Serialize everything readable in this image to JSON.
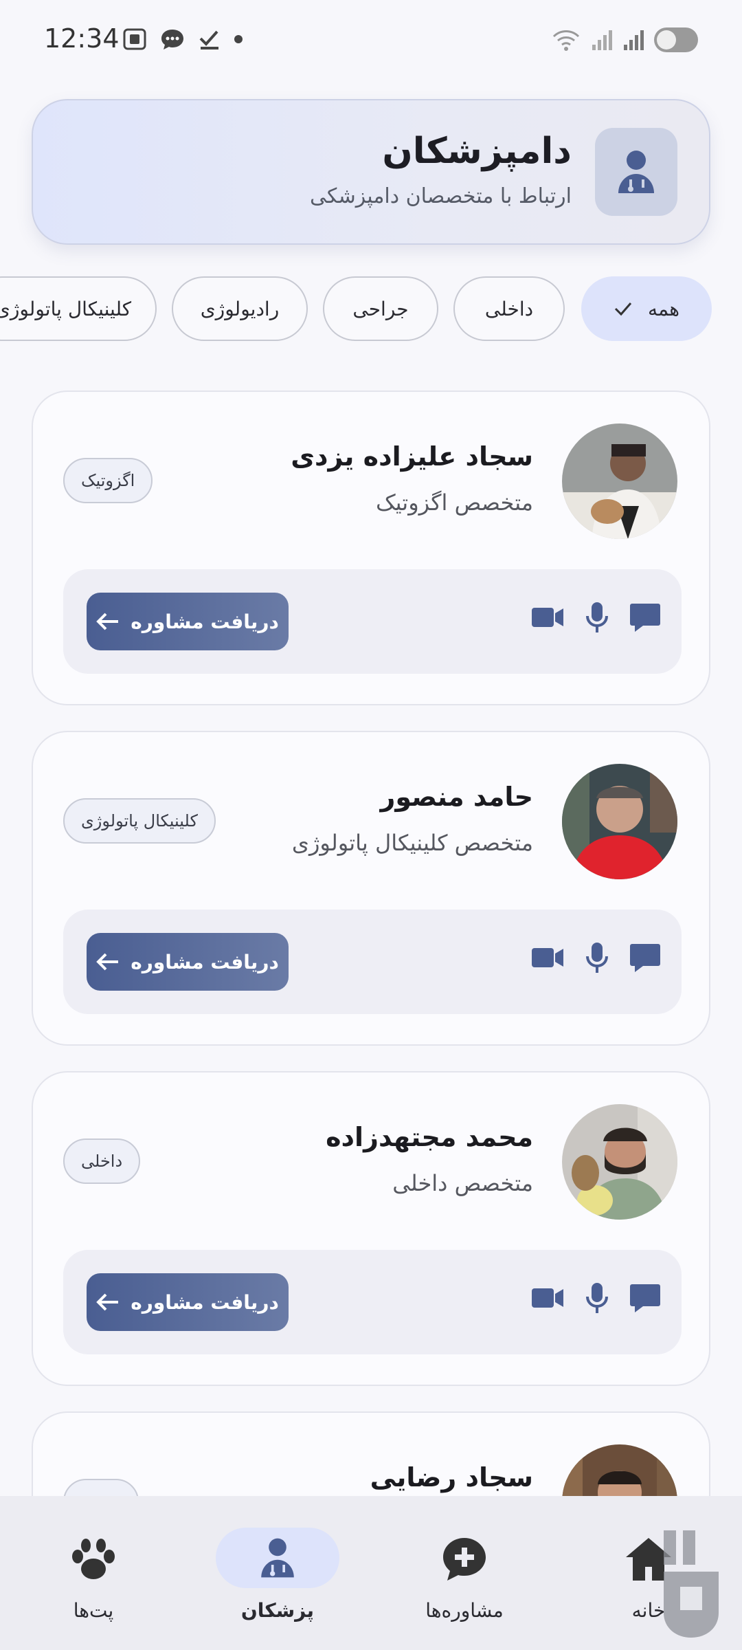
{
  "status_bar": {
    "time": "12:34",
    "icons": [
      "screenshot-icon",
      "message-icon",
      "check-icon",
      "dot-icon"
    ],
    "right_icons": [
      "wifi-icon",
      "signal-icon",
      "signal-icon",
      "battery-toggle"
    ]
  },
  "header": {
    "title": "دامپزشکان",
    "subtitle": "ارتباط با متخصصان دامپزشکی",
    "icon": "doctor-icon"
  },
  "filters": {
    "items": [
      {
        "label": "همه",
        "active": true
      },
      {
        "label": "داخلی",
        "active": false
      },
      {
        "label": "جراحی",
        "active": false
      },
      {
        "label": "رادیولوژی",
        "active": false
      },
      {
        "label": "کلینیکال پاتولوژی",
        "active": false
      }
    ]
  },
  "doctors": [
    {
      "name": "سجاد علیزاده یزدی",
      "specialty": "متخصص اگزوتیک",
      "tag": "اگزوتیک",
      "button": "دریافت مشاوره"
    },
    {
      "name": "حامد منصور",
      "specialty": "متخصص کلینیکال پاتولوژی",
      "tag": "کلینیکال پاتولوژی",
      "button": "دریافت مشاوره"
    },
    {
      "name": "محمد مجتهدزاده",
      "specialty": "متخصص داخلی",
      "tag": "داخلی",
      "button": "دریافت مشاوره"
    },
    {
      "name": "سجاد رضایی",
      "specialty": "",
      "tag": "",
      "button": ""
    }
  ],
  "bottom_nav": {
    "items": [
      {
        "label": "پت‌ها",
        "icon": "paw-icon",
        "active": false
      },
      {
        "label": "پزشکان",
        "icon": "doctor-icon",
        "active": true
      },
      {
        "label": "مشاوره‌ها",
        "icon": "chat-plus-icon",
        "active": false
      },
      {
        "label": "خانه",
        "icon": "home-icon",
        "active": false
      }
    ]
  },
  "colors": {
    "accent": "#4a5e92",
    "chip_active": "#dde3fb",
    "background": "#f7f7fb"
  }
}
